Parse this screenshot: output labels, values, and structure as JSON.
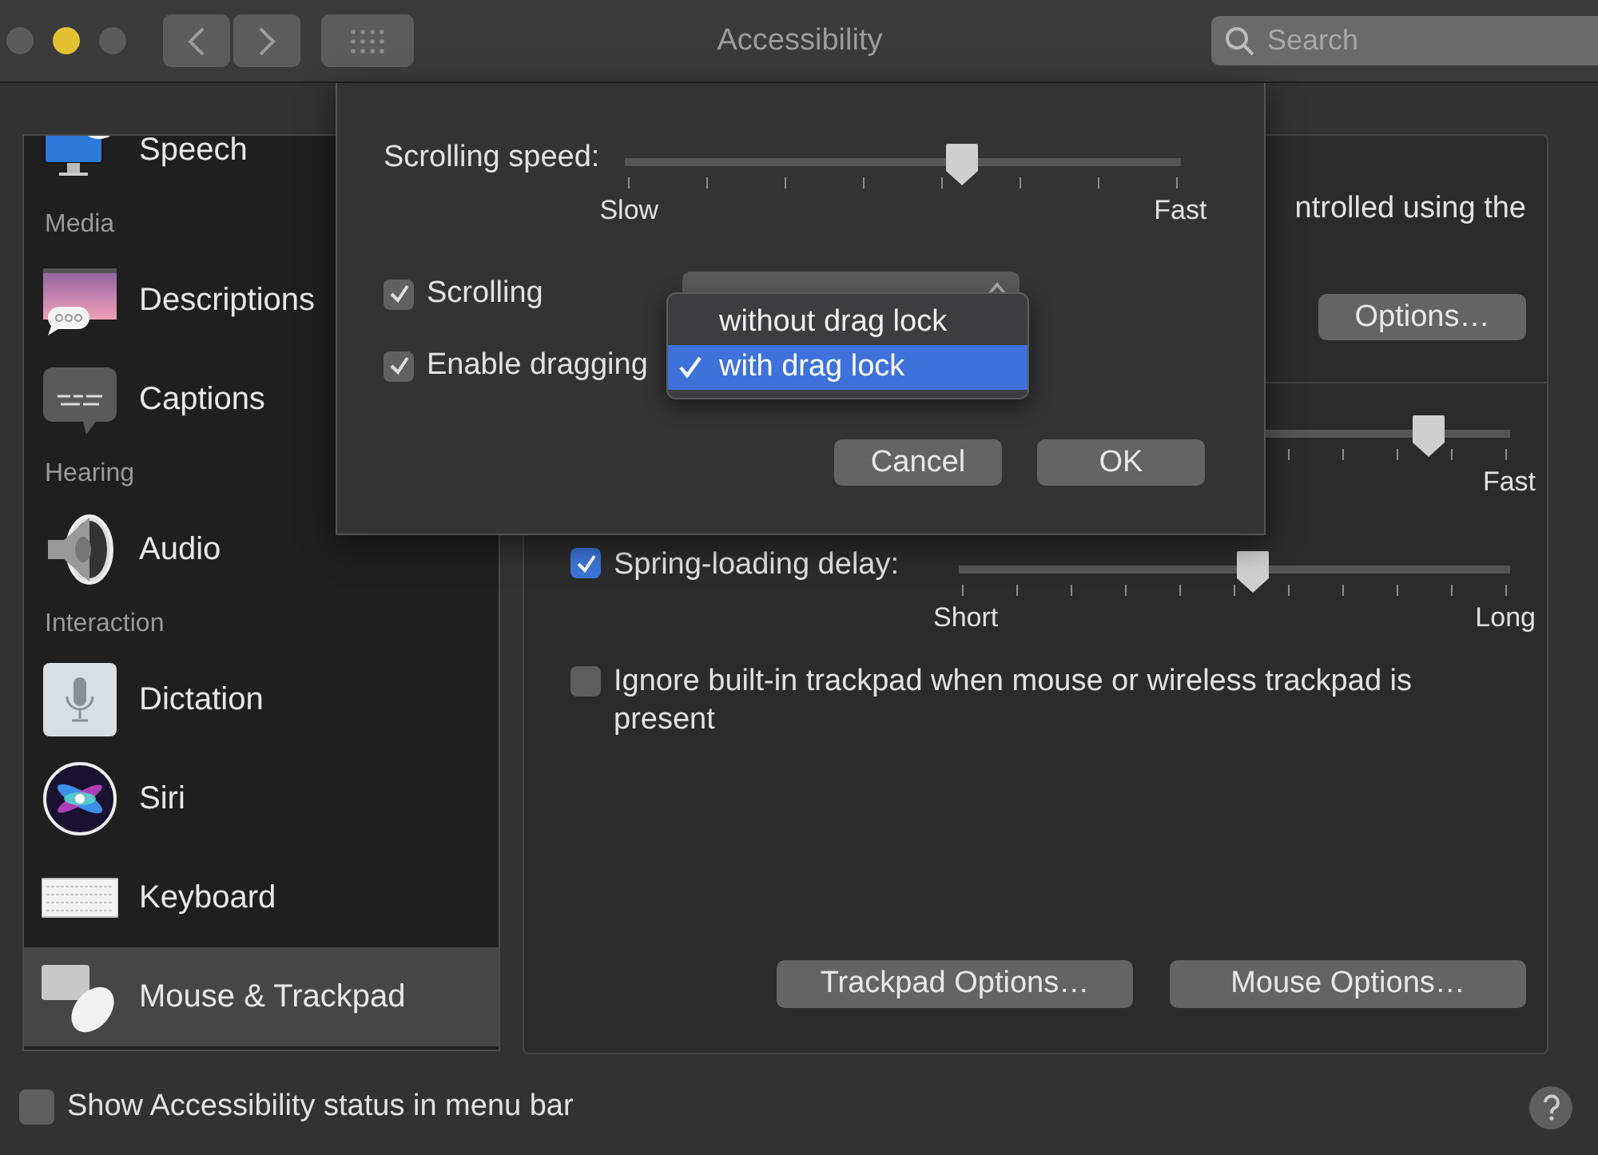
{
  "window": {
    "title": "Accessibility"
  },
  "search": {
    "placeholder": "Search"
  },
  "sidebar": {
    "items": [
      {
        "kind": "item",
        "label": "Speech",
        "selected": false
      },
      {
        "kind": "header",
        "label": "Media"
      },
      {
        "kind": "item",
        "label": "Descriptions",
        "selected": false
      },
      {
        "kind": "item",
        "label": "Captions",
        "selected": false
      },
      {
        "kind": "header",
        "label": "Hearing"
      },
      {
        "kind": "item",
        "label": "Audio",
        "selected": false
      },
      {
        "kind": "header",
        "label": "Interaction"
      },
      {
        "kind": "item",
        "label": "Dictation",
        "selected": false
      },
      {
        "kind": "item",
        "label": "Siri",
        "selected": false
      },
      {
        "kind": "item",
        "label": "Keyboard",
        "selected": false
      },
      {
        "kind": "item",
        "label": "Mouse & Trackpad",
        "selected": true
      }
    ]
  },
  "panel": {
    "intro_text": "ntrolled using the",
    "options_button": "Options…",
    "slider_1": {
      "level": 0.8,
      "max_label": "Fast"
    },
    "spring_loading": {
      "label": "Spring-loading delay:",
      "checked": true,
      "level": 0.5,
      "min_label": "Short",
      "max_label": "Long"
    },
    "ignore_trackpad": {
      "label": "Ignore built-in trackpad when mouse or wireless trackpad is present",
      "checked": false
    },
    "buttons": [
      "Trackpad Options…",
      "Mouse Options…"
    ]
  },
  "sheet": {
    "scrolling_speed": {
      "label": "Scrolling speed:",
      "level": 0.571,
      "min_label": "Slow",
      "max_label": "Fast"
    },
    "scrolling": {
      "label": "Scrolling",
      "checked": true
    },
    "dragging": {
      "label": "Enable dragging",
      "checked": true
    },
    "menu": [
      {
        "label": "without drag lock",
        "selected": false
      },
      {
        "label": "with drag lock",
        "selected": true
      }
    ],
    "buttons": [
      "Cancel",
      "OK"
    ]
  },
  "show_status": {
    "label": "Show Accessibility status in menu bar",
    "checked": false
  }
}
